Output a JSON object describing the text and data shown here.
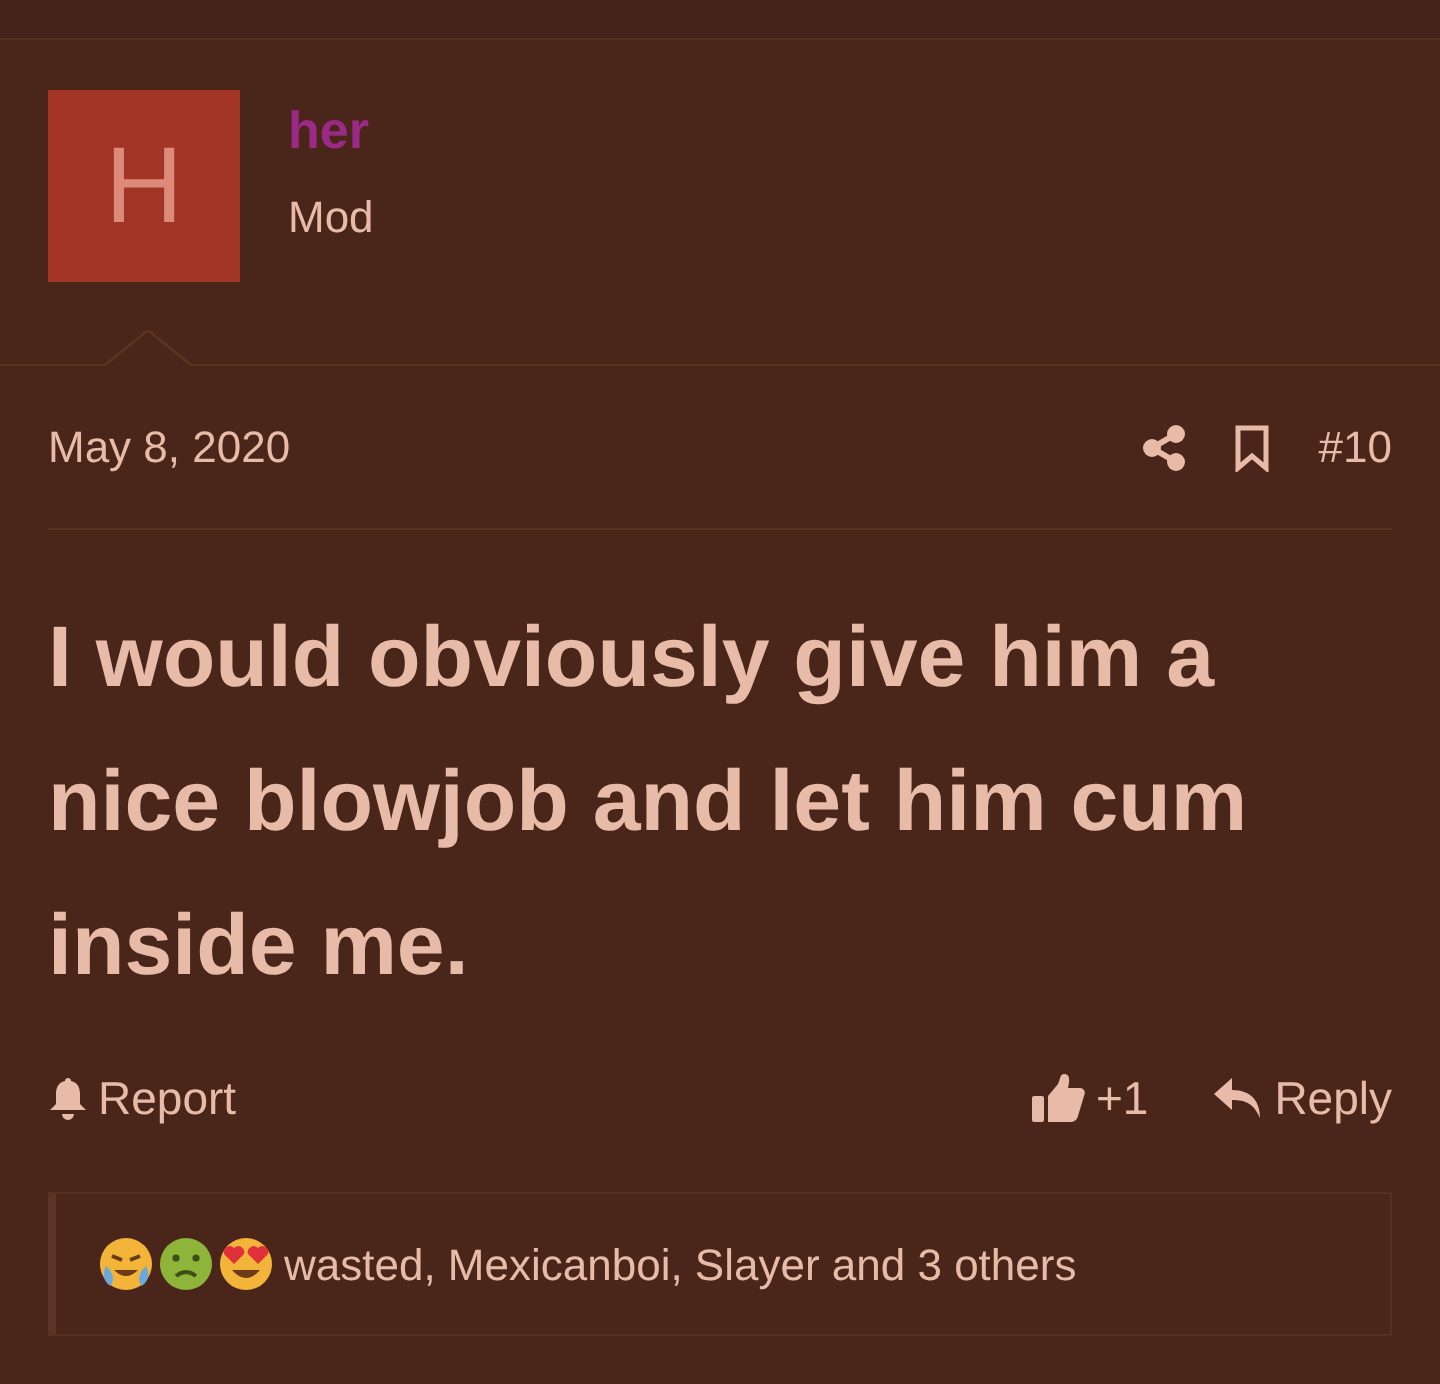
{
  "author": {
    "avatar_letter": "H",
    "name": "her",
    "role": "Mod"
  },
  "post": {
    "date": "May 8, 2020",
    "number": "#10",
    "text": "I would obviously give him a nice blowjob and let him cum inside me."
  },
  "actions": {
    "report": "Report",
    "like_count": "+1",
    "reply": "Reply"
  },
  "reactions": {
    "summary": "wasted, Mexicanboi, Slayer and 3 others",
    "icons": [
      {
        "kind": "crying"
      },
      {
        "kind": "sick"
      },
      {
        "kind": "hearts"
      }
    ]
  }
}
